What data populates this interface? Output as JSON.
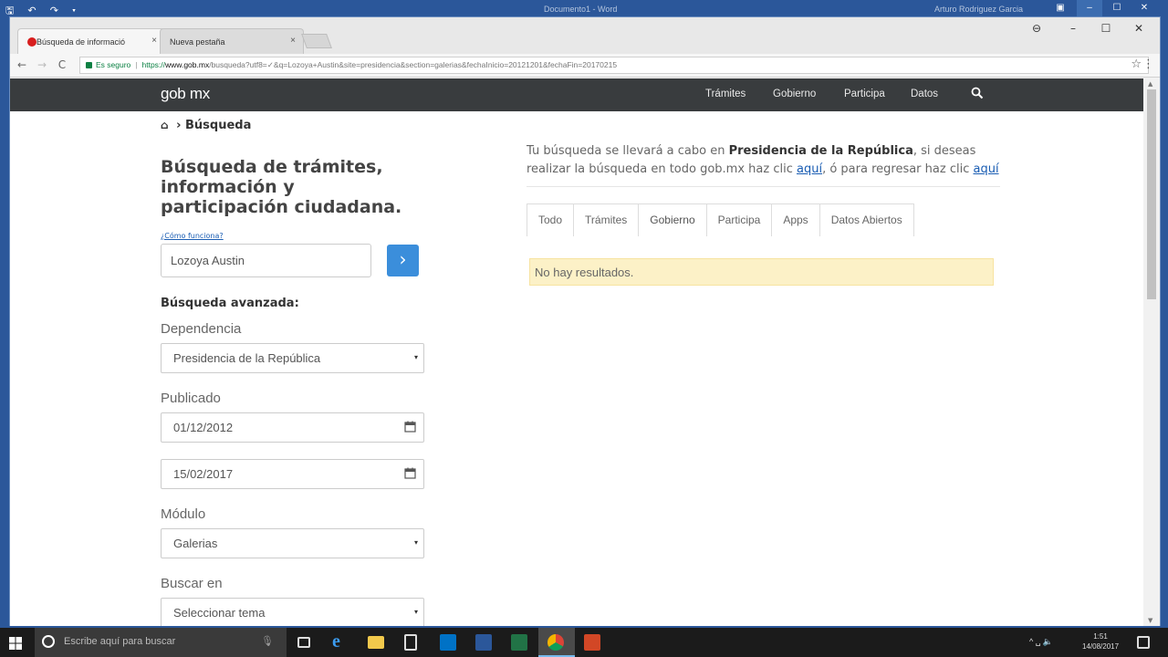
{
  "word": {
    "qat": "🖫 ↶ ↷ ▾",
    "title": "Documento1 - Word",
    "user": "Arturo Rodriguez Garcia"
  },
  "browser": {
    "tabs": [
      {
        "label": "Búsqueda de informació",
        "close": "×"
      },
      {
        "label": "Nueva pestaña",
        "close": "×"
      }
    ],
    "nav": {
      "back": "←",
      "forward": "→",
      "reload": "C"
    },
    "address": {
      "secure_label": "Es seguro",
      "protocol": "https://",
      "host": "www.gob.mx",
      "path": "/busqueda?utf8=✓&q=Lozoya+Austin&site=presidencia&section=galerias&fechaInicio=20121201&fechaFin=20170215"
    },
    "star": "☆",
    "menu": "⋮",
    "window": {
      "account": "⊖",
      "minimize": "–",
      "maximize": "☐",
      "close": "✕"
    }
  },
  "site": {
    "logo": "gob mx",
    "nav": [
      "Trámites",
      "Gobierno",
      "Participa",
      "Datos"
    ],
    "breadcrumb": {
      "home_icon": "home-icon",
      "sep": "›",
      "current": "Búsqueda"
    }
  },
  "left": {
    "title": "Búsqueda de trámites, información y participación ciudadana.",
    "how_link": "¿Cómo funciona?",
    "search_value": "Lozoya Austin",
    "search_button": "›",
    "advanced_title": "Búsqueda avanzada:",
    "dependencia_label": "Dependencia",
    "dependencia_value": "Presidencia de la República",
    "publicado_label": "Publicado",
    "fecha_inicio": "01/12/2012",
    "fecha_fin": "15/02/2017",
    "modulo_label": "Módulo",
    "modulo_value": "Galerias",
    "buscar_en_label": "Buscar en",
    "buscar_en_value": "Seleccionar tema",
    "caret": "▾"
  },
  "right": {
    "msg_prefix": "Tu búsqueda se llevará a cabo en ",
    "msg_bold": "Presidencia de la República",
    "msg_middle": ", si deseas realizar la búsqueda en todo gob.mx haz clic ",
    "msg_link1": "aquí",
    "msg_middle2": ", ó para regresar haz clic ",
    "msg_link2": "aquí",
    "tabs": [
      "Todo",
      "Trámites",
      "Gobierno",
      "Participa",
      "Apps",
      "Datos Abiertos"
    ],
    "active_tab": "Gobierno",
    "no_results": "No hay resultados."
  },
  "taskbar": {
    "search_placeholder": "Escribe aquí para buscar",
    "time": "1:51",
    "date": "14/08/2017",
    "tray": "^ ␣ 🔈"
  },
  "colors": {
    "gob_nav": "#393c3e",
    "accent_blue": "#3b8edb",
    "alert_bg": "#fcf1c7",
    "word_blue": "#2b579a"
  }
}
